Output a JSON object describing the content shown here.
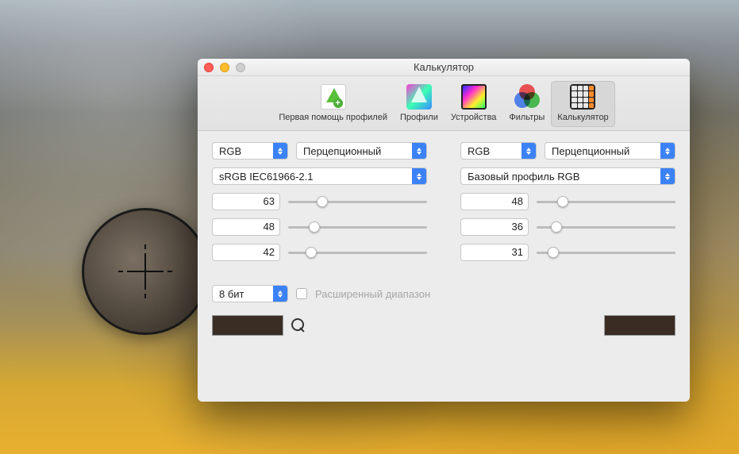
{
  "window": {
    "title": "Калькулятор"
  },
  "toolbar": {
    "items": [
      {
        "label": "Первая помощь профилей"
      },
      {
        "label": "Профили"
      },
      {
        "label": "Устройства"
      },
      {
        "label": "Фильтры"
      },
      {
        "label": "Калькулятор"
      }
    ],
    "selectedIndex": 4
  },
  "left": {
    "colorSpace": "RGB",
    "renderingIntent": "Перцепционный",
    "profile": "sRGB IEC61966-2.1",
    "channels": [
      {
        "value": "63",
        "pct": 24.7
      },
      {
        "value": "48",
        "pct": 18.8
      },
      {
        "value": "42",
        "pct": 16.5
      }
    ],
    "swatchColor": "#3a2e24"
  },
  "right": {
    "colorSpace": "RGB",
    "renderingIntent": "Перцепционный",
    "profile": "Базовый профиль RGB",
    "channels": [
      {
        "value": "48",
        "pct": 18.8
      },
      {
        "value": "36",
        "pct": 14.1
      },
      {
        "value": "31",
        "pct": 12.2
      }
    ],
    "swatchColor": "#3a2c22"
  },
  "bottom": {
    "bitDepth": "8 бит",
    "extendedRangeLabel": "Расширенный диапазон",
    "extendedRangeChecked": false
  }
}
